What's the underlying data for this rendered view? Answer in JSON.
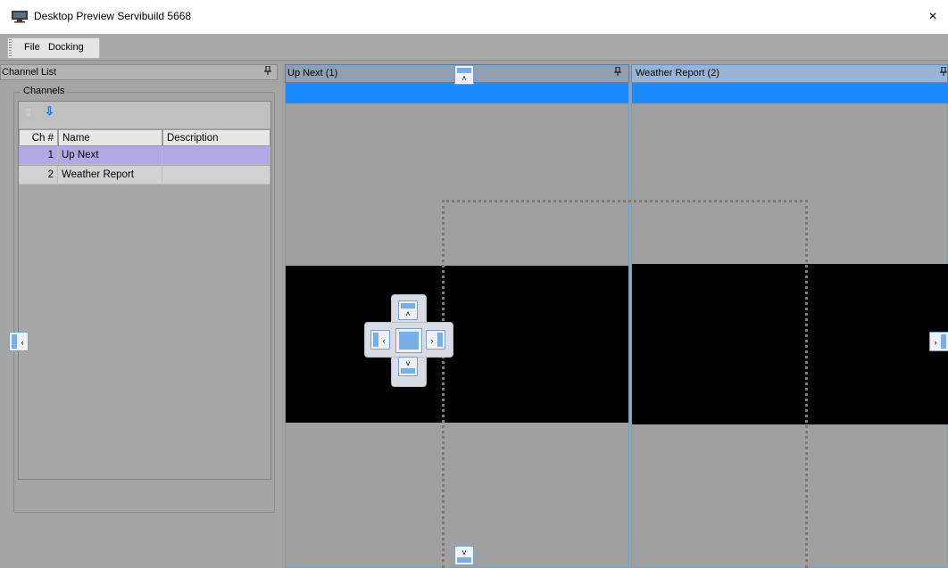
{
  "window": {
    "title": "Desktop Preview Servibuild 5668",
    "icon": "monitor-icon",
    "close_label": "×"
  },
  "menu": {
    "items": [
      "File",
      "Docking"
    ]
  },
  "channel_list": {
    "header": "Channel List",
    "pin_icon": "pin-icon",
    "group_title": "Channels",
    "toolbar": {
      "move_up_icon": "arrow-up-icon",
      "move_down_icon": "arrow-down-icon"
    },
    "columns": [
      "Ch #",
      "Name",
      "Description"
    ],
    "rows": [
      {
        "ch": "1",
        "name": "Up Next",
        "description": "",
        "selected": true
      },
      {
        "ch": "2",
        "name": "Weather Report",
        "description": "",
        "selected": false
      }
    ]
  },
  "panels": [
    {
      "title": "Up Next (1)",
      "pin_icon": "pin-icon",
      "accent": "#1a8cff"
    },
    {
      "title": "Weather Report (2)",
      "pin_icon": "pin-icon",
      "accent": "#1a8cff"
    }
  ],
  "dock_guides": {
    "left": "‹",
    "right": "›",
    "top": "˄",
    "bottom": "˅",
    "center_up": "˄",
    "center_down": "˅",
    "center_left": "‹",
    "center_right": "›"
  },
  "colors": {
    "selection": "#b3a8e6",
    "accent_blue": "#1a8cff",
    "background": "#a0a0a0"
  }
}
